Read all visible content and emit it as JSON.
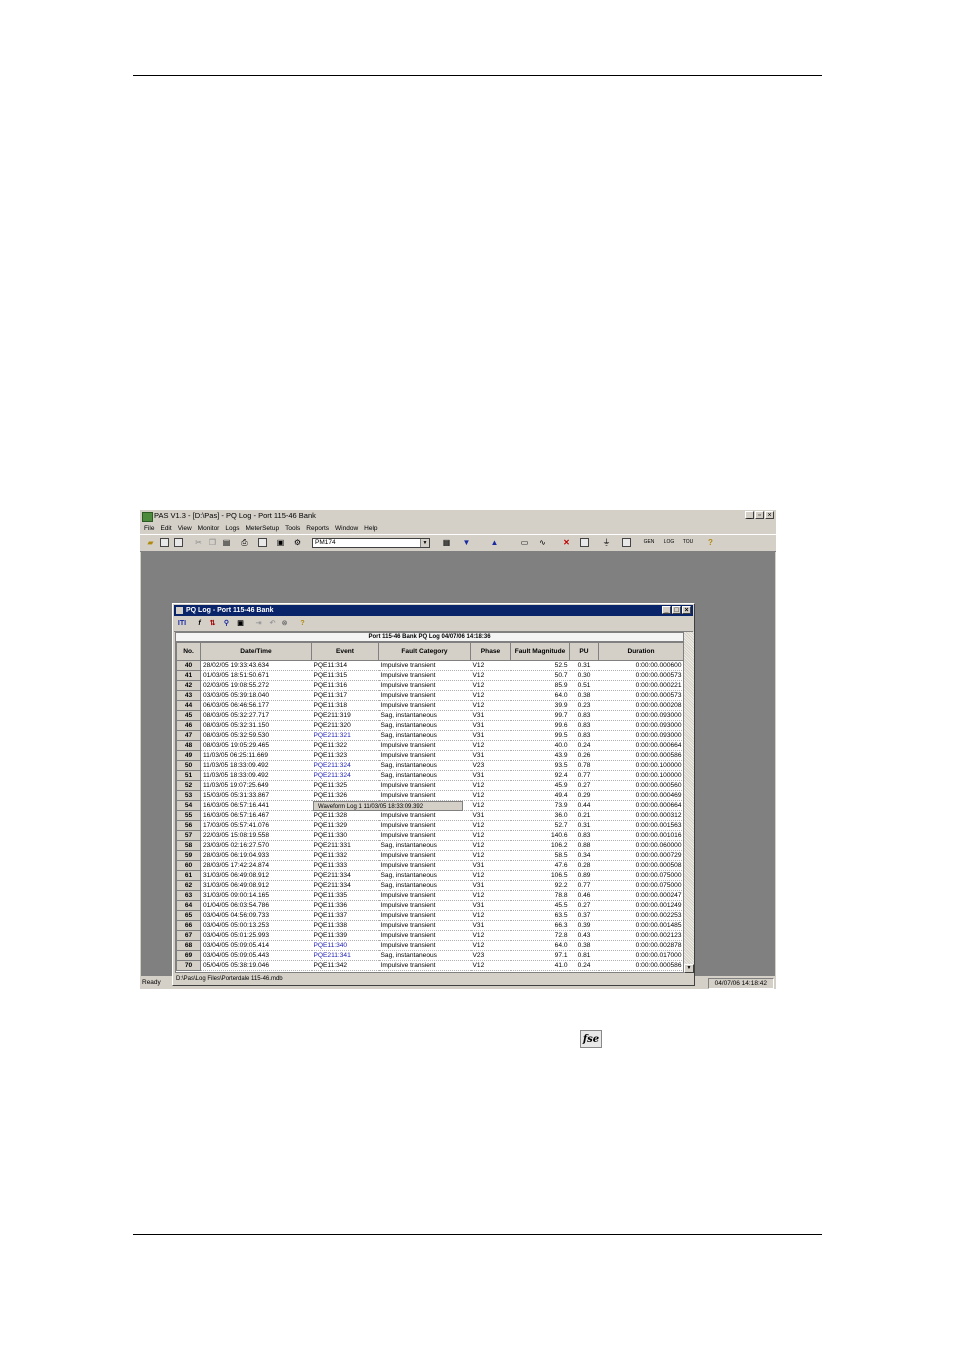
{
  "app": {
    "title": "PAS V1.3 - [D:\\Pas] - PQ Log - Port 115-46 Bank",
    "menu": [
      "File",
      "Edit",
      "View",
      "Monitor",
      "Logs",
      "MeterSetup",
      "Tools",
      "Reports",
      "Window",
      "Help"
    ],
    "site_combo": "PM174",
    "toolbar_labels": {
      "gen": "GEN",
      "log": "LOG",
      "tou": "TOU"
    },
    "status_left": "Ready",
    "status_right": "04/07/06 14:18:42"
  },
  "child": {
    "title": "PQ Log - Port 115-46 Bank",
    "toolbar_text": "ITI",
    "grid_title": "Port 115-46 Bank    PQ Log    04/07/06 14:18:36",
    "status": "D:\\Pas\\Log Files\\Porterdale 115-46.mdb",
    "tooltip": "Waveform Log 1   11/03/05  18:33:09.392",
    "columns": [
      "No.",
      "Date/Time",
      "Event",
      "Fault Category",
      "Phase",
      "Fault Magnitude",
      "PU",
      "Duration"
    ],
    "rows": [
      [
        "40",
        "28/02/05  19:33:43.634",
        "PQE11:314",
        "Impulsive transient",
        "V12",
        "52.5",
        "0.31",
        "0:00:00.000600"
      ],
      [
        "41",
        "01/03/05  18:51:50.671",
        "PQE11:315",
        "Impulsive transient",
        "V12",
        "50.7",
        "0.30",
        "0:00:00.000573"
      ],
      [
        "42",
        "02/03/05  19:08:55.272",
        "PQE11:316",
        "Impulsive transient",
        "V12",
        "85.9",
        "0.51",
        "0:00:00.000221"
      ],
      [
        "43",
        "03/03/05  05:39:18.040",
        "PQE11:317",
        "Impulsive transient",
        "V12",
        "64.0",
        "0.38",
        "0:00:00.000573"
      ],
      [
        "44",
        "06/03/05  06:46:56.177",
        "PQE11:318",
        "Impulsive transient",
        "V12",
        "39.9",
        "0.23",
        "0:00:00.000208"
      ],
      [
        "45",
        "08/03/05  05:32:27.717",
        "PQE211:319",
        "Sag, instantaneous",
        "V31",
        "99.7",
        "0.83",
        "0:00:00.093000"
      ],
      [
        "46",
        "08/03/05  05:32:31.150",
        "PQE211:320",
        "Sag, instantaneous",
        "V31",
        "99.6",
        "0.83",
        "0:00:00.093000"
      ],
      [
        "47",
        "08/03/05  05:32:59.530",
        "PQE211:321",
        "Sag, instantaneous",
        "V31",
        "99.5",
        "0.83",
        "0:00:00.093000"
      ],
      [
        "48",
        "08/03/05  19:05:29.465",
        "PQE11:322",
        "Impulsive transient",
        "V12",
        "40.0",
        "0.24",
        "0:00:00.000664"
      ],
      [
        "49",
        "11/03/05  06:25:11.669",
        "PQE11:323",
        "Impulsive transient",
        "V31",
        "43.9",
        "0.26",
        "0:00:00.000586"
      ],
      [
        "50",
        "11/03/05  18:33:09.492",
        "PQE211:324",
        "Sag, instantaneous",
        "V23",
        "93.5",
        "0.78",
        "0:00:00.100000"
      ],
      [
        "51",
        "11/03/05  18:33:09.492",
        "PQE211:324",
        "Sag, instantaneous",
        "V31",
        "92.4",
        "0.77",
        "0:00:00.100000"
      ],
      [
        "52",
        "11/03/05  19:07:25.649",
        "PQE11:325",
        "Impulsive transient",
        "V12",
        "45.9",
        "0.27",
        "0:00:00.000560"
      ],
      [
        "53",
        "15/03/05  05:31:33.867",
        "PQE11:326",
        "Impulsive transient",
        "V12",
        "49.4",
        "0.29",
        "0:00:00.000469"
      ],
      [
        "54",
        "16/03/05  06:57:16.441",
        "PQE11:327",
        "Impulsive transient",
        "V12",
        "73.9",
        "0.44",
        "0:00:00.000664"
      ],
      [
        "55",
        "16/03/05  06:57:16.467",
        "PQE11:328",
        "Impulsive transient",
        "V31",
        "36.0",
        "0.21",
        "0:00:00.000312"
      ],
      [
        "56",
        "17/03/05  05:57:41.076",
        "PQE11:329",
        "Impulsive transient",
        "V12",
        "52.7",
        "0.31",
        "0:00:00.001563"
      ],
      [
        "57",
        "22/03/05  15:08:19.558",
        "PQE11:330",
        "Impulsive transient",
        "V12",
        "140.6",
        "0.83",
        "0:00:00.001016"
      ],
      [
        "58",
        "23/03/05  02:16:27.570",
        "PQE211:331",
        "Sag, instantaneous",
        "V12",
        "106.2",
        "0.88",
        "0:00:00.060000"
      ],
      [
        "59",
        "28/03/05  06:19:04.933",
        "PQE11:332",
        "Impulsive transient",
        "V12",
        "58.5",
        "0.34",
        "0:00:00.000729"
      ],
      [
        "60",
        "28/03/05  17:42:24.874",
        "PQE11:333",
        "Impulsive transient",
        "V31",
        "47.6",
        "0.28",
        "0:00:00.000508"
      ],
      [
        "61",
        "31/03/05  06:49:08.912",
        "PQE211:334",
        "Sag, instantaneous",
        "V12",
        "106.5",
        "0.89",
        "0:00:00.075000"
      ],
      [
        "62",
        "31/03/05  06:49:08.912",
        "PQE211:334",
        "Sag, instantaneous",
        "V31",
        "92.2",
        "0.77",
        "0:00:00.075000"
      ],
      [
        "63",
        "31/03/05  09:00:14.165",
        "PQE11:335",
        "Impulsive transient",
        "V12",
        "78.8",
        "0.46",
        "0:00:00.000247"
      ],
      [
        "64",
        "01/04/05  06:03:54.786",
        "PQE11:336",
        "Impulsive transient",
        "V31",
        "45.5",
        "0.27",
        "0:00:00.001249"
      ],
      [
        "65",
        "03/04/05  04:56:09.733",
        "PQE11:337",
        "Impulsive transient",
        "V12",
        "63.5",
        "0.37",
        "0:00:00.002253"
      ],
      [
        "66",
        "03/04/05  05:00:13.253",
        "PQE11:338",
        "Impulsive transient",
        "V31",
        "66.3",
        "0.39",
        "0:00:00.001485"
      ],
      [
        "67",
        "03/04/05  05:01:25.993",
        "PQE11:339",
        "Impulsive transient",
        "V12",
        "72.8",
        "0.43",
        "0:00:00.002123"
      ],
      [
        "68",
        "03/04/05  05:09:05.414",
        "PQE11:340",
        "Impulsive transient",
        "V12",
        "64.0",
        "0.38",
        "0:00:00.002878"
      ],
      [
        "69",
        "03/04/05  05:09:05.443",
        "PQE211:341",
        "Sag, instantaneous",
        "V23",
        "97.1",
        "0.81",
        "0:00:00.017000"
      ],
      [
        "70",
        "05/04/05  05:38:19.046",
        "PQE11:342",
        "Impulsive transient",
        "V12",
        "41.0",
        "0.24",
        "0:00:00.000586"
      ]
    ],
    "blue_event_rows": [
      "47",
      "50",
      "51",
      "68",
      "69"
    ]
  },
  "inline_icon_text": "fse",
  "colors": {
    "title_active": "#0a246a",
    "workspace": "#808080",
    "link_blue": "#1a1ab4"
  }
}
